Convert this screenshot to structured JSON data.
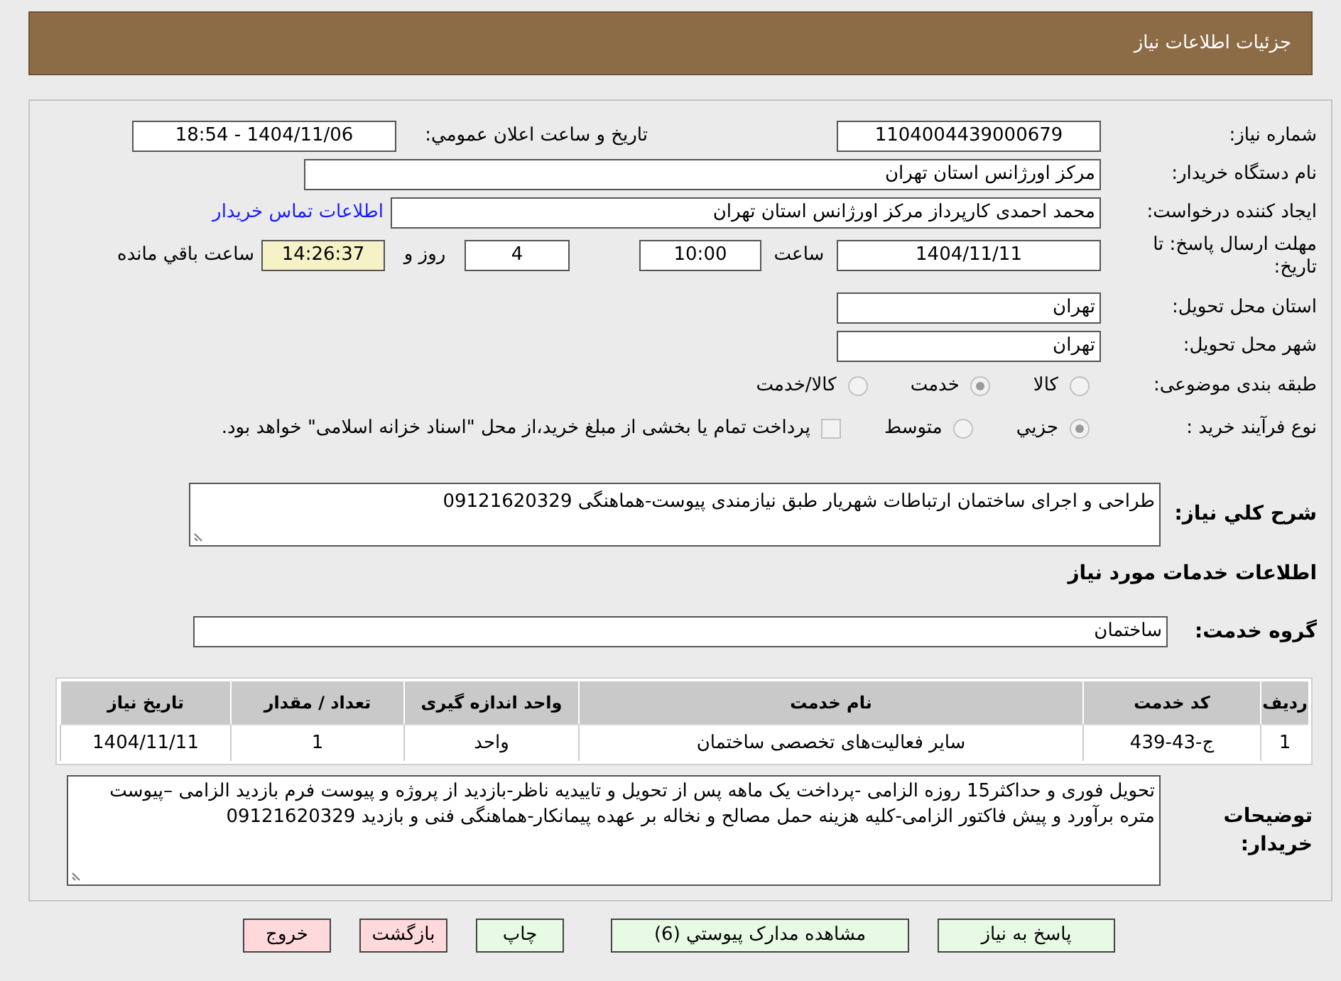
{
  "header": {
    "title": "جزئیات اطلاعات نیاز"
  },
  "need_number": {
    "label": "شماره نیاز:",
    "value": "1104004439000679"
  },
  "announce": {
    "label": "تاريخ و ساعت اعلان عمومي:",
    "value": "1404/11/06 - 18:54"
  },
  "buyer_org": {
    "label": "نام دستگاه خریدار:",
    "value": "مرکز اورژانس استان تهران"
  },
  "requester": {
    "label": "ایجاد کننده درخواست:",
    "value": "محمد احمدی کارپرداز مرکز اورژانس استان تهران",
    "link": "اطلاعات تماس خریدار"
  },
  "deadline": {
    "label": "مهلت ارسال پاسخ: تا تاریخ:",
    "date": "1404/11/11",
    "time_label": "ساعت",
    "time": "10:00",
    "days": "4",
    "days_label": "روز و",
    "remaining": "14:26:37",
    "remaining_label": "ساعت باقي مانده"
  },
  "province": {
    "label": "استان محل تحویل:",
    "value": "تهران"
  },
  "city": {
    "label": "شهر محل تحویل:",
    "value": "تهران"
  },
  "category": {
    "label": "طبقه بندی موضوعی:",
    "options": [
      {
        "label": "كالا",
        "selected": false
      },
      {
        "label": "خدمت",
        "selected": true
      },
      {
        "label": "كالا/خدمت",
        "selected": false
      }
    ]
  },
  "process": {
    "label": "نوع فرآیند خرید :",
    "options": [
      {
        "label": "جزيي",
        "selected": true
      },
      {
        "label": "متوسط",
        "selected": false
      }
    ],
    "payment": {
      "checked": false,
      "label": "پرداخت تمام یا بخشی از مبلغ خرید،از محل \"اسناد خزانه اسلامی\" خواهد بود."
    }
  },
  "description": {
    "label": "شرح كلي نیاز:",
    "value": "طراحی و اجرای ساختمان ارتباطات شهریار طبق نیازمندی پیوست-هماهنگی 09121620329"
  },
  "services_heading": "اطلاعات خدمات مورد نیاز",
  "service_group": {
    "label": "گروه خدمت:",
    "value": "ساختمان"
  },
  "table": {
    "columns": [
      "ردیف",
      "کد خدمت",
      "نام خدمت",
      "واحد اندازه گیری",
      "تعداد / مقدار",
      "تاریخ نیاز"
    ],
    "rows": [
      [
        "1",
        "ج-43-439",
        "سایر فعالیت‌های تخصصی ساختمان",
        "واحد",
        "1",
        "1404/11/11"
      ]
    ]
  },
  "buyer_notes": {
    "label": "توضیحات خریدار:",
    "value": "تحویل فوری و حداکثر15 روزه الزامی -پرداخت یک ماهه پس از تحویل و تاییدیه ناظر-بازدید از پروژه و پیوست فرم بازدید الزامی –پیوست متره برآورد و پیش فاکتور الزامی-کلیه هزینه حمل مصالح و نخاله بر عهده پیمانکار-هماهنگی فنی و بازدید 09121620329"
  },
  "buttons": [
    {
      "label": "پاسخ به نیاز",
      "kind": "primary"
    },
    {
      "label": "مشاهده مدارک پيوستي (6)",
      "kind": "primary"
    },
    {
      "label": "چاپ",
      "kind": "primary"
    },
    {
      "label": "بازگشت",
      "kind": "danger"
    },
    {
      "label": "خروج",
      "kind": "danger"
    }
  ]
}
